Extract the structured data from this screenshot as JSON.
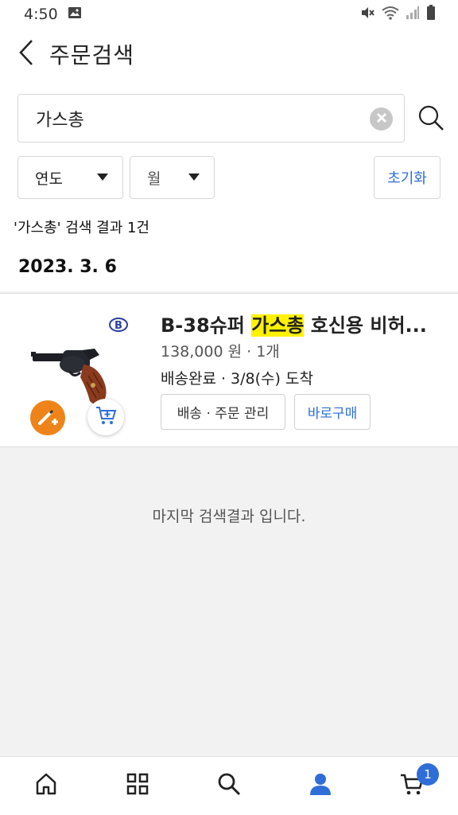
{
  "status_bar": {
    "time": "4:50"
  },
  "header": {
    "title": "주문검색"
  },
  "search": {
    "query": "가스총"
  },
  "filters": {
    "year_label": "연도",
    "month_label": "월",
    "reset_label": "초기화"
  },
  "results": {
    "summary": "'가스총' 검색 결과 1건"
  },
  "order_groups": [
    {
      "date": "2023. 3. 6",
      "items": [
        {
          "title_prefix": "B-38슈퍼 ",
          "title_highlight": "가스총",
          "title_suffix": " 호신용 비허...",
          "price_qty": "138,000 원 · 1개",
          "status": "배송완료 · 3/8(수) 도착",
          "manage_label": "배송 · 주문 관리",
          "reorder_label": "바로구매"
        }
      ]
    }
  ],
  "end_message": "마지막 검색결과 입니다.",
  "bottom_nav": {
    "cart_count": "1"
  },
  "colors": {
    "accent": "#2f6ed8",
    "highlight": "#fff200",
    "promo": "#ee8419"
  },
  "icons": [
    "image-icon",
    "mute-icon",
    "wifi-icon",
    "signal-icon",
    "battery-icon",
    "back-icon",
    "clear-icon",
    "search-icon",
    "brand-logo-icon",
    "revolver-image",
    "promo-badge-icon",
    "cart-plus-icon",
    "home-icon",
    "category-icon",
    "nav-search-icon",
    "my-page-icon",
    "cart-icon"
  ]
}
